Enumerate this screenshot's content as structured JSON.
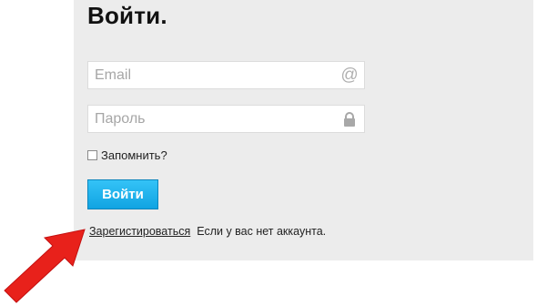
{
  "login": {
    "title": "Войти.",
    "email_placeholder": "Email",
    "password_placeholder": "Пароль",
    "email_icon": "at-icon",
    "password_icon": "lock-icon",
    "remember_label": "Запомнить?",
    "submit_label": "Войти",
    "register_link": "Зарегистироваться",
    "register_hint": "Если у вас нет аккаунта."
  },
  "colors": {
    "panel_bg": "#ececec",
    "button": "#1aaeea",
    "arrow": "#e8211b"
  }
}
